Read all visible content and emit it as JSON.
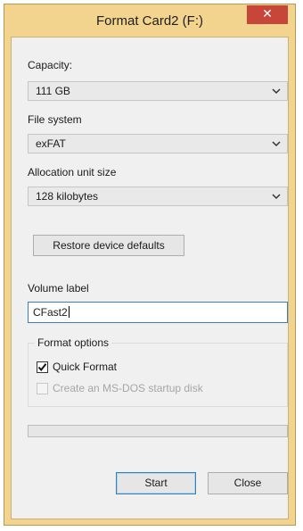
{
  "window": {
    "title": "Format Card2 (F:)",
    "close_glyph": "✕"
  },
  "capacity": {
    "label": "Capacity:",
    "value": "111 GB"
  },
  "file_system": {
    "label": "File system",
    "value": "exFAT"
  },
  "allocation_unit": {
    "label": "Allocation unit size",
    "value": "128 kilobytes"
  },
  "restore_button": {
    "label": "Restore device defaults"
  },
  "volume_label": {
    "label": "Volume label",
    "value": "CFast2"
  },
  "format_options": {
    "title": "Format options",
    "quick_format": {
      "label": "Quick Format",
      "checked": true,
      "enabled": true
    },
    "msdos_startup": {
      "label": "Create an MS-DOS startup disk",
      "checked": false,
      "enabled": false
    }
  },
  "progress": {
    "percent": 0
  },
  "buttons": {
    "start": "Start",
    "close": "Close"
  },
  "colors": {
    "frame": "#f3d48e",
    "close_button": "#c7463a",
    "dialog_bg": "#f0f0f0",
    "focus_border": "#3c7fb1",
    "progress_fill": "#06b025"
  }
}
